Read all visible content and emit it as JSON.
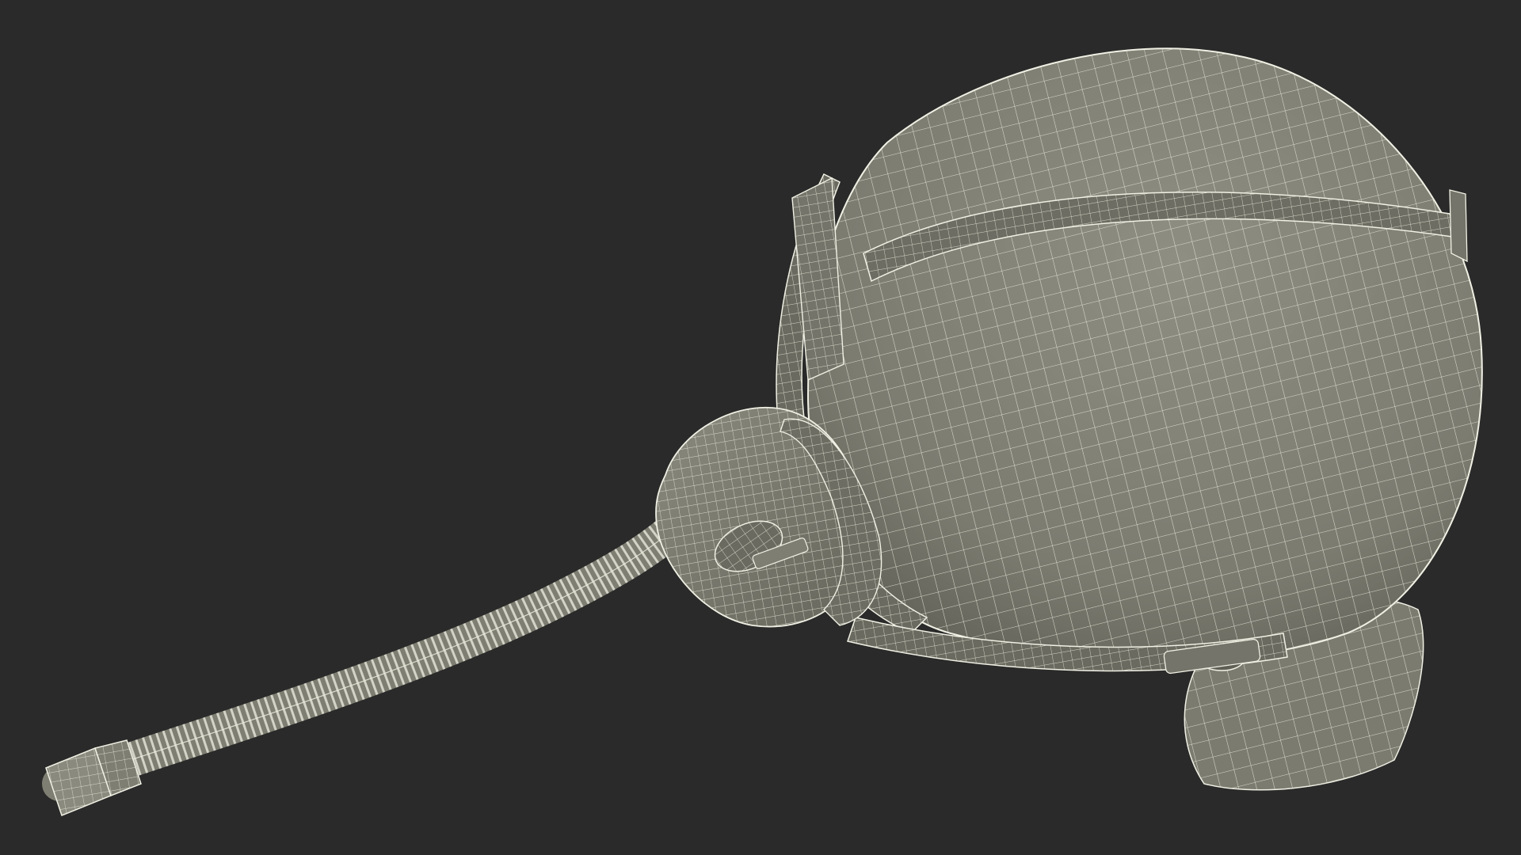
{
  "scene": {
    "subject": "pilot-helmet-with-oxygen-mask",
    "render_style": "wireframe-over-shaded",
    "colors": {
      "background": "#2a2a2a",
      "surface": "#828276",
      "surface_dark": "#5f5f56",
      "surface_light": "#9a9a8c",
      "wire": "#e9e9dc"
    }
  }
}
